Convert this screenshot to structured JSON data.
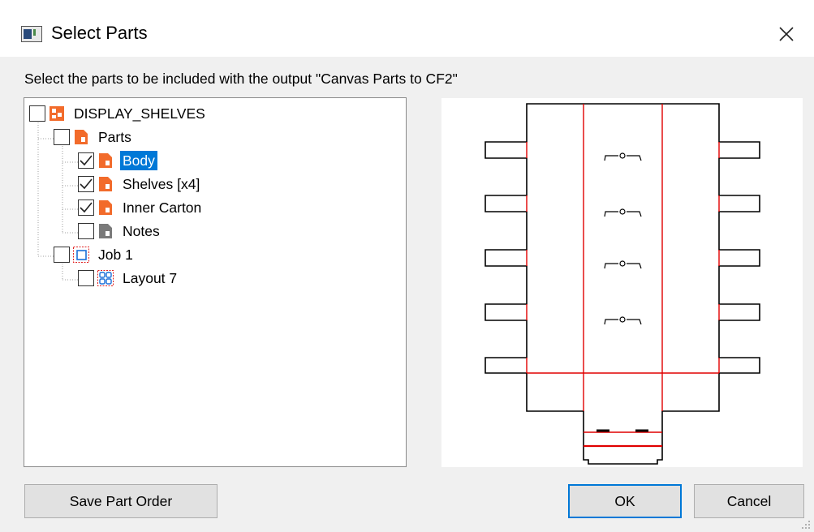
{
  "dialog": {
    "title": "Select Parts",
    "instruction": "Select the parts to be included with the output \"Canvas Parts to CF2\""
  },
  "tree": {
    "items": [
      {
        "label": "DISPLAY_SHELVES",
        "checked": false,
        "icon": "assembly-icon"
      },
      {
        "label": "Parts",
        "checked": false,
        "icon": "part-folder-icon"
      },
      {
        "label": "Body",
        "checked": true,
        "selected": true,
        "icon": "part-icon"
      },
      {
        "label": "Shelves [x4]",
        "checked": true,
        "icon": "part-icon"
      },
      {
        "label": "Inner Carton",
        "checked": true,
        "icon": "part-icon"
      },
      {
        "label": "Notes",
        "checked": false,
        "icon": "notes-icon"
      },
      {
        "label": "Job 1",
        "checked": false,
        "icon": "job-icon"
      },
      {
        "label": "Layout 7",
        "checked": false,
        "icon": "layout-icon"
      }
    ]
  },
  "buttons": {
    "save_order": "Save Part Order",
    "ok": "OK",
    "cancel": "Cancel"
  },
  "colors": {
    "accent": "#0078d7",
    "part_orange": "#f26b2b",
    "cut_line": "#000000",
    "crease_line": "#e00000"
  }
}
